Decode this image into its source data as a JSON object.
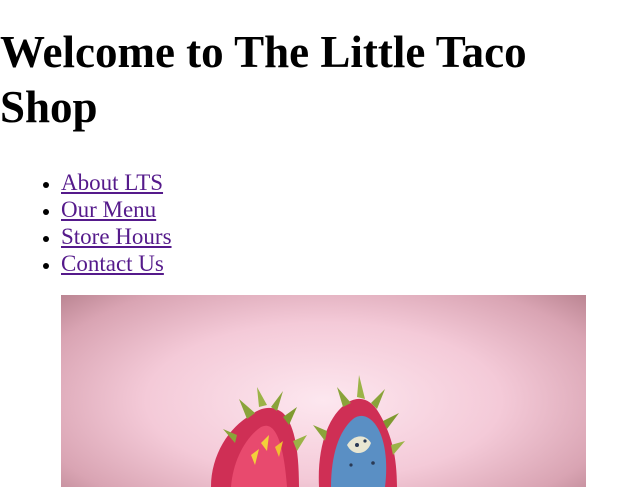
{
  "header": {
    "title": "Welcome to The Little Taco Shop"
  },
  "nav": {
    "items": [
      {
        "label": "About LTS"
      },
      {
        "label": "Our Menu"
      },
      {
        "label": "Store Hours"
      },
      {
        "label": "Contact Us"
      }
    ]
  },
  "colors": {
    "link_visited": "#551a8b",
    "hero_background": "#f4cad8",
    "fruit_skin": "#d63a5a",
    "fruit_leaf": "#8aa33a",
    "fruit_interior": "#5a8fc4"
  },
  "hero": {
    "image": "dragon-fruit-photo"
  }
}
